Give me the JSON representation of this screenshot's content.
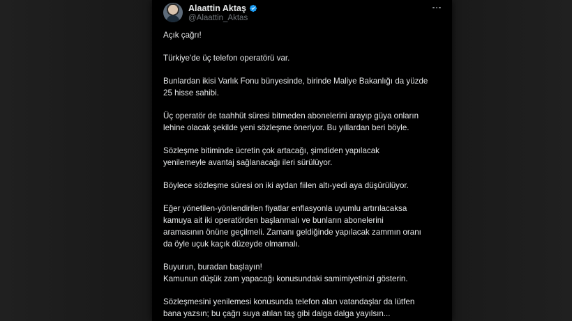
{
  "tweet": {
    "author": {
      "display_name": "Alaattin Aktaş",
      "handle": "@Alaattin_Aktas",
      "verified": true,
      "verified_color": "#1d9bf0"
    },
    "more_icon": "more-horizontal-icon",
    "paragraphs": [
      [
        "Açık çağrı!"
      ],
      [
        "Türkiye'de üç telefon operatörü var."
      ],
      [
        "Bunlardan ikisi Varlık Fonu bünyesinde, birinde Maliye Bakanlığı da yüzde",
        "25 hisse sahibi."
      ],
      [
        "Üç operatör de taahhüt süresi bitmeden abonelerini arayıp güya onların",
        "lehine olacak şekilde yeni sözleşme öneriyor. Bu yıllardan beri böyle."
      ],
      [
        "Sözleşme bitiminde ücretin çok artacağı, şimdiden yapılacak",
        "yenilemeyle avantaj sağlanacağı ileri sürülüyor."
      ],
      [
        "Böylece sözleşme süresi on iki aydan fiilen altı-yedi aya düşürülüyor."
      ],
      [
        "Eğer yönetilen-yönlendirilen fiyatlar enflasyonla uyumlu artırılacaksa",
        "kamuya ait iki operatörden başlanmalı ve bunların abonelerini",
        "aramasının önüne geçilmeli. Zamanı geldiğinde yapılacak zammın oranı",
        "da öyle uçuk kaçık düzeyde olmamalı."
      ],
      [
        "Buyurun, buradan başlayın!",
        "Kamunun düşük zam yapacağı konusundaki samimiyetinizi gösterin."
      ],
      [
        "Sözleşmesini yenilemesi konusunda telefon alan vatandaşlar da lütfen",
        "bana yazsın; bu çağrı suya atılan taş gibi dalga dalga yayılsın..."
      ]
    ]
  },
  "colors": {
    "card_background": "#000000",
    "text_primary": "#e7e9ea",
    "text_secondary": "#71767b",
    "outer_background": "#1c1c1c"
  }
}
